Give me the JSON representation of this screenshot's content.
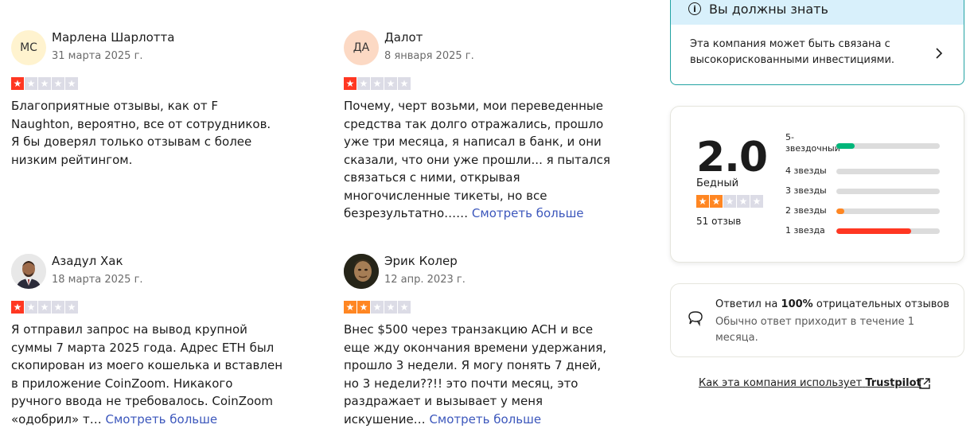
{
  "colors": {
    "star_red": "#ff3722",
    "star_orange": "#ff8622",
    "star_empty": "#dcdce6",
    "bar_green": "#00b67a",
    "bar_orange": "#ff8622",
    "bar_red": "#ff3722",
    "link": "#3c57bc",
    "notice_bg": "#d8f0fb"
  },
  "reviews": [
    {
      "initials": "МС",
      "name": "Марлена Шарлотта",
      "date": "31 марта 2025 г.",
      "rating": 1,
      "lines": [
        "Благоприятные отзывы, как от F",
        "Naughton, вероятно, все от сотрудников.",
        "Я бы доверял только отзывам с более",
        "низким рейтингом."
      ],
      "more": ""
    },
    {
      "initials": "ДА",
      "name": "Далот",
      "date": "8 января 2025 г.",
      "rating": 1,
      "lines": [
        "Почему, черт возьми, мои переведенные",
        "средства так долго отражались, прошло",
        "уже три месяца, я написал в банк, и они",
        "сказали, что они уже прошли... я пытался",
        "связаться с ними, открывая",
        "многочисленные тикеты, но все"
      ],
      "last_line": "безрезультатно……",
      "more": "Смотреть больше"
    },
    {
      "initials": "",
      "avatar_icon": "person-photo-icon",
      "name": "Азадул Хак",
      "date": "18 марта 2025 г.",
      "rating": 1,
      "lines": [
        "Я отправил запрос на вывод крупной",
        "суммы 7 марта 2025 года. Адрес ETH был",
        "скопирован из моего кошелька и вставлен",
        "в приложение CoinZoom. Никакого",
        "ручного ввода не требовалось. CoinZoom"
      ],
      "last_line": "«одобрил» т…",
      "more": "Смотреть больше"
    },
    {
      "initials": "",
      "avatar_icon": "person-photo-icon",
      "name": "Эрик Колер",
      "date": "12 апр. 2023 г.",
      "rating": 2,
      "lines": [
        "Внес $500 через транзакцию ACH и все",
        "еще жду окончания времени удержания,",
        "прошло 3 недели. Я могу понять 7 дней,",
        "но 3 недели??!! это почти месяц, это",
        "раздражает и вызывает у меня"
      ],
      "last_line": "искушение…",
      "more": "Смотреть больше"
    }
  ],
  "notice": {
    "title": "Вы должны знать",
    "line1": "Эта компания может быть связана с",
    "line2": "высокорискованными инвестициями."
  },
  "summary": {
    "score": "2.0",
    "label": "Бедный",
    "rating": 2,
    "count": "51 отзыв",
    "bars": [
      {
        "label": "5-звездочный",
        "fraction": 0.18,
        "color": "#00b67a"
      },
      {
        "label": "4 звезды",
        "fraction": 0.0,
        "color": "#dcdcdc"
      },
      {
        "label": "3 звезды",
        "fraction": 0.0,
        "color": "#dcdcdc"
      },
      {
        "label": "2 звезды",
        "fraction": 0.08,
        "color": "#ff8622"
      },
      {
        "label": "1 звезда",
        "fraction": 0.72,
        "color": "#ff3722"
      }
    ]
  },
  "reply": {
    "pre": "Ответил на",
    "pct": "100%",
    "post": "отрицательных отзывов",
    "line2": "Обычно ответ приходит в течение 1",
    "line3": "месяца."
  },
  "trustpilot": {
    "pre": "Как эта компания использует",
    "brand": "Trustpilot"
  }
}
